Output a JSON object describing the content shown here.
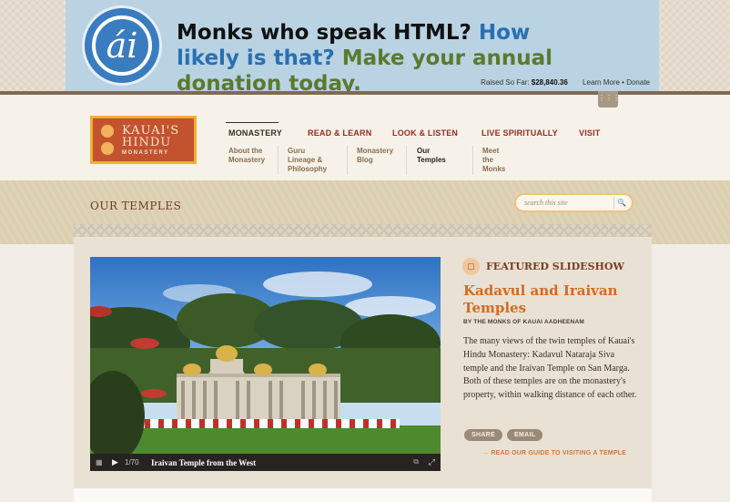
{
  "banner": {
    "headline_part1": "Monks who speak HTML?",
    "headline_part2": "How likely is that?",
    "headline_part3": "Make your annual donation today.",
    "raised_label": "Raised So Far:",
    "raised_amount": "$28,840.36",
    "links": "Learn More • Donate",
    "logo_glyph": "ái",
    "colors": {
      "background": "#b9d3e3",
      "blue": "#2a6fb2",
      "green": "#5b7a2e"
    }
  },
  "site_logo": {
    "line1": "KAUAI'S",
    "line2": "HINDU",
    "line3": "MONASTERY"
  },
  "nav": {
    "items": [
      {
        "label": "MONASTERY"
      },
      {
        "label": "READ & LEARN"
      },
      {
        "label": "LOOK & LISTEN"
      },
      {
        "label": "LIVE SPIRITUALLY"
      },
      {
        "label": "VISIT"
      }
    ],
    "sub_items": [
      {
        "label": "About the Monastery"
      },
      {
        "label": "Guru Lineage & Philosophy"
      },
      {
        "label": "Monastery Blog"
      },
      {
        "label": "Our Temples"
      },
      {
        "label": "Meet the Monks"
      }
    ]
  },
  "page": {
    "section_title": "OUR TEMPLES"
  },
  "search": {
    "placeholder": "search this site"
  },
  "slideshow": {
    "counter": "1/70",
    "caption": "Iraivan Temple from the West"
  },
  "featured": {
    "label": "FEATURED SLIDESHOW",
    "title": "Kadavul and Iraivan Temples",
    "byline": "BY THE MONKS OF KAUAI AADHEENAM",
    "description": "The many views of the twin temples of Kauai's Hindu Monastery: Kadavul Nataraja Siva temple and the Iraivan Temple on San Marga. Both of these temples are on the monastery's property, within walking distance of each other.",
    "share_label": "SHARE",
    "email_label": "EMAIL",
    "guide_link": "READ OUR GUIDE TO VISITING A TEMPLE"
  },
  "icons": [
    "banner-logo-icon",
    "search-icon",
    "slideshow-icon",
    "grid-icon",
    "play-icon",
    "expand-icon",
    "fullscreen-icon",
    "arrow-right-icon"
  ]
}
